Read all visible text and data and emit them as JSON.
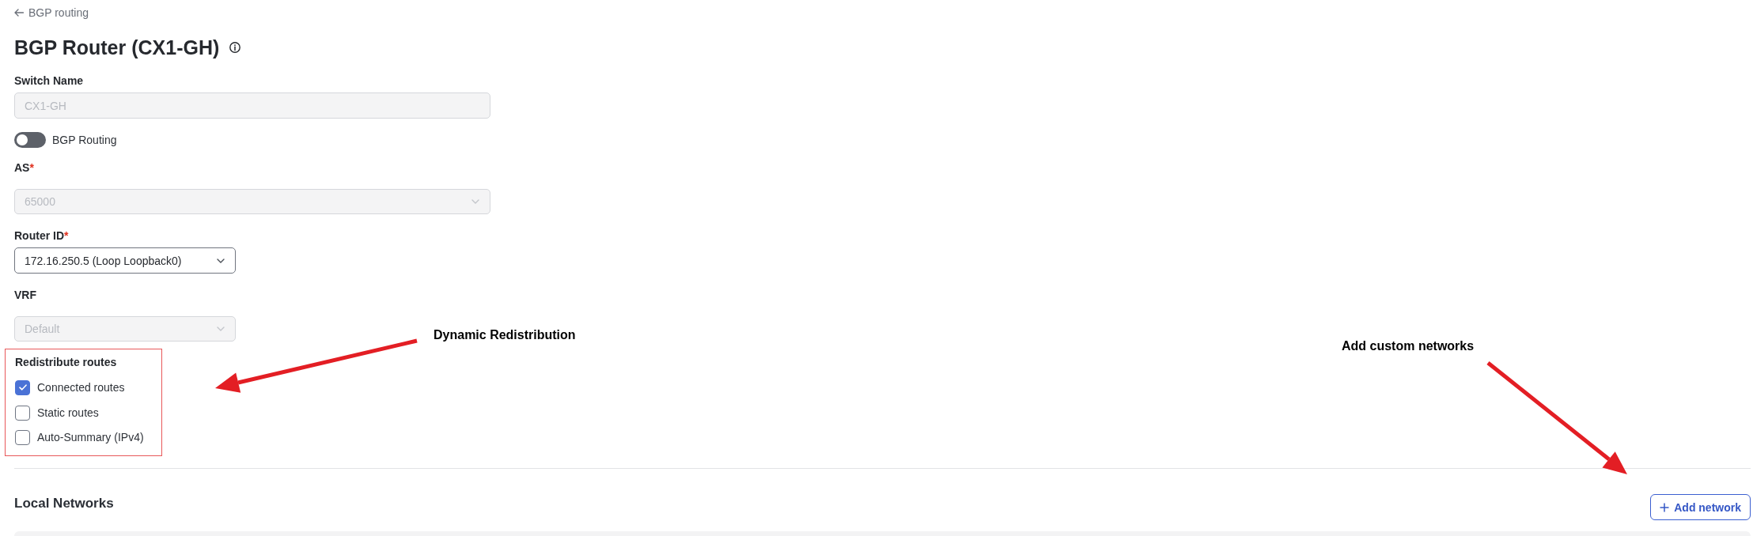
{
  "back_link": {
    "label": "BGP routing"
  },
  "title": "BGP Router (CX1-GH)",
  "switch_name": {
    "label": "Switch Name",
    "value": "CX1-GH",
    "disabled": true
  },
  "bgp_routing": {
    "label": "BGP Routing",
    "on": false
  },
  "as": {
    "label": "AS",
    "required_mark": "*",
    "value": "65000",
    "disabled": true
  },
  "router_id": {
    "label": "Router ID",
    "required_mark": "*",
    "value": "172.16.250.5 (Loop Loopback0)",
    "disabled": false
  },
  "vrf": {
    "label": "VRF",
    "value": "Default",
    "disabled": true
  },
  "redistribute_routes": {
    "title": "Redistribute routes",
    "options": [
      {
        "label": "Connected routes",
        "checked": true
      },
      {
        "label": "Static routes",
        "checked": false
      },
      {
        "label": "Auto-Summary (IPv4)",
        "checked": false
      }
    ]
  },
  "local_networks": {
    "title": "Local Networks",
    "add_button": {
      "label": "Add network"
    }
  },
  "annotations": [
    {
      "text": "Dynamic Redistribution"
    },
    {
      "text": "Add custom networks"
    }
  ]
}
